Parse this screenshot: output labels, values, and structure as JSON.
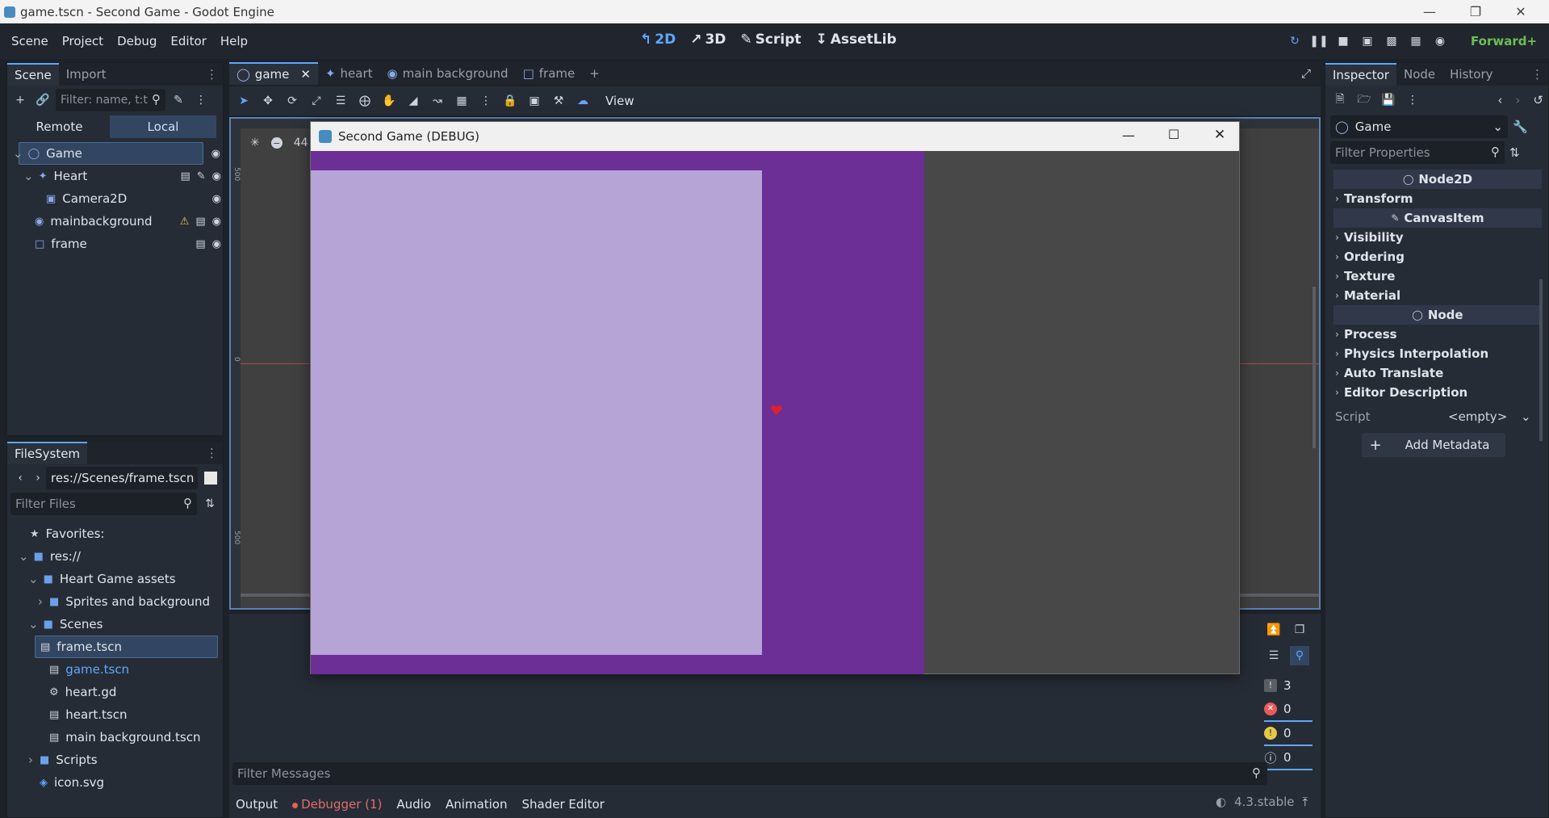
{
  "window": {
    "title": "game.tscn - Second Game - Godot Engine"
  },
  "menu": [
    "Scene",
    "Project",
    "Debug",
    "Editor",
    "Help"
  ],
  "main_screens": [
    {
      "label": "2D",
      "icon": "2d-icon",
      "active": true
    },
    {
      "label": "3D",
      "icon": "3d-icon",
      "active": false
    },
    {
      "label": "Script",
      "icon": "script-icon",
      "active": false
    },
    {
      "label": "AssetLib",
      "icon": "assetlib-icon",
      "active": false
    }
  ],
  "renderer": "Forward+",
  "scene_dock": {
    "tabs": [
      "Scene",
      "Import"
    ],
    "filter_placeholder": "Filter: name, t:t",
    "remote_label": "Remote",
    "local_label": "Local",
    "nodes": [
      {
        "name": "Game",
        "type": "node2d",
        "depth": 0,
        "selected": true
      },
      {
        "name": "Heart",
        "type": "character",
        "depth": 1,
        "selected": false
      },
      {
        "name": "Camera2D",
        "type": "camera",
        "depth": 2,
        "selected": false
      },
      {
        "name": "mainbackground",
        "type": "sprite",
        "depth": 1,
        "selected": false,
        "warning": true
      },
      {
        "name": "frame",
        "type": "frame",
        "depth": 1,
        "selected": false
      }
    ]
  },
  "filesystem": {
    "title": "FileSystem",
    "path": "res://Scenes/frame.tscn",
    "filter_placeholder": "Filter Files",
    "items": [
      {
        "label": "Favorites:",
        "kind": "star",
        "depth": 0
      },
      {
        "label": "res://",
        "kind": "folder",
        "depth": 0
      },
      {
        "label": "Heart Game assets",
        "kind": "folder",
        "depth": 1
      },
      {
        "label": "Sprites and background",
        "kind": "folder",
        "depth": 2
      },
      {
        "label": "Scenes",
        "kind": "folder",
        "depth": 1
      },
      {
        "label": "frame.tscn",
        "kind": "scene",
        "depth": 2,
        "selected": true
      },
      {
        "label": "game.tscn",
        "kind": "scene",
        "depth": 2,
        "accent": true
      },
      {
        "label": "heart.gd",
        "kind": "gear",
        "depth": 2
      },
      {
        "label": "heart.tscn",
        "kind": "scene",
        "depth": 2
      },
      {
        "label": "main background.tscn",
        "kind": "scene",
        "depth": 2
      },
      {
        "label": "Scripts",
        "kind": "folder",
        "depth": 1
      },
      {
        "label": "icon.svg",
        "kind": "image",
        "depth": 1
      }
    ]
  },
  "editor_tabs": [
    "game",
    "heart",
    "main background",
    "frame"
  ],
  "toolbar": {
    "view_label": "View",
    "zoom_partial": "44"
  },
  "ruler": {
    "v_top": "500",
    "v_mid": "0",
    "v_bottom": "500"
  },
  "debug_window": {
    "title": "Second Game (DEBUG)"
  },
  "inspector": {
    "tabs": [
      "Inspector",
      "Node",
      "History"
    ],
    "object_name": "Game",
    "filter_placeholder": "Filter Properties",
    "categories": [
      {
        "name": "Node2D",
        "sections": [
          "Transform"
        ]
      },
      {
        "name": "CanvasItem",
        "sections": [
          "Visibility",
          "Ordering",
          "Texture",
          "Material"
        ]
      },
      {
        "name": "Node",
        "sections": [
          "Process",
          "Physics Interpolation",
          "Auto Translate",
          "Editor Description"
        ]
      }
    ],
    "script_label": "Script",
    "script_value": "<empty>",
    "add_metadata": "Add Metadata"
  },
  "output": {
    "filter_placeholder": "Filter Messages",
    "count_messages": "3",
    "count_errors": "0",
    "count_warnings": "0",
    "count_info": "0"
  },
  "bottom_tabs": [
    "Output",
    "Debugger (1)",
    "Audio",
    "Animation",
    "Shader Editor"
  ],
  "version": "4.3.stable"
}
